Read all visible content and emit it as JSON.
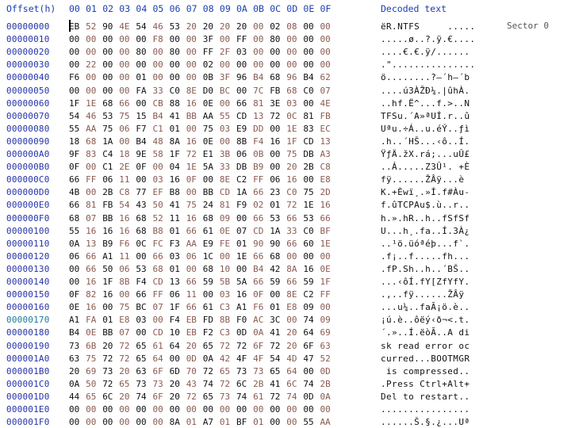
{
  "header": {
    "offset_label": "Offset(h)",
    "columns": [
      "00",
      "01",
      "02",
      "03",
      "04",
      "05",
      "06",
      "07",
      "08",
      "09",
      "0A",
      "0B",
      "0C",
      "0D",
      "0E",
      "0F"
    ],
    "decoded_label": "Decoded text"
  },
  "sector_label": "Sector 0",
  "colors": {
    "header": "#1a3fb0",
    "offset": "#2432a8",
    "byte_dark": "#111111",
    "byte_light": "#8a5a50"
  },
  "rows": [
    {
      "offset": "00000000",
      "bytes": [
        "EB",
        "52",
        "90",
        "4E",
        "54",
        "46",
        "53",
        "20",
        "20",
        "20",
        "20",
        "00",
        "02",
        "08",
        "00",
        "00"
      ],
      "text": "ëR.NTFS     ....."
    },
    {
      "offset": "00000010",
      "bytes": [
        "00",
        "00",
        "00",
        "00",
        "00",
        "F8",
        "00",
        "00",
        "3F",
        "00",
        "FF",
        "00",
        "80",
        "00",
        "00",
        "00"
      ],
      "text": ".....ø..?.ÿ.€...."
    },
    {
      "offset": "00000020",
      "bytes": [
        "00",
        "00",
        "00",
        "00",
        "80",
        "00",
        "80",
        "00",
        "FF",
        "2F",
        "03",
        "00",
        "00",
        "00",
        "00",
        "00"
      ],
      "text": "....€.€.ÿ/......"
    },
    {
      "offset": "00000030",
      "bytes": [
        "00",
        "22",
        "00",
        "00",
        "00",
        "00",
        "00",
        "00",
        "02",
        "00",
        "00",
        "00",
        "00",
        "00",
        "00",
        "00"
      ],
      "text": ".\"..............."
    },
    {
      "offset": "00000040",
      "bytes": [
        "F6",
        "00",
        "00",
        "00",
        "01",
        "00",
        "00",
        "00",
        "0B",
        "3F",
        "96",
        "B4",
        "68",
        "96",
        "B4",
        "62"
      ],
      "text": "ö........?–´h–´b"
    },
    {
      "offset": "00000050",
      "bytes": [
        "00",
        "00",
        "00",
        "00",
        "FA",
        "33",
        "C0",
        "8E",
        "D0",
        "BC",
        "00",
        "7C",
        "FB",
        "68",
        "C0",
        "07"
      ],
      "text": "....ú3ÀŽÐ¼.|ûhÀ."
    },
    {
      "offset": "00000060",
      "bytes": [
        "1F",
        "1E",
        "68",
        "66",
        "00",
        "CB",
        "88",
        "16",
        "0E",
        "00",
        "66",
        "81",
        "3E",
        "03",
        "00",
        "4E"
      ],
      "text": "..hf.Ë^...f.>..N"
    },
    {
      "offset": "00000070",
      "bytes": [
        "54",
        "46",
        "53",
        "75",
        "15",
        "B4",
        "41",
        "BB",
        "AA",
        "55",
        "CD",
        "13",
        "72",
        "0C",
        "81",
        "FB"
      ],
      "text": "TFSu.´A»ªUÍ.r..û"
    },
    {
      "offset": "00000080",
      "bytes": [
        "55",
        "AA",
        "75",
        "06",
        "F7",
        "C1",
        "01",
        "00",
        "75",
        "03",
        "E9",
        "DD",
        "00",
        "1E",
        "83",
        "EC"
      ],
      "text": "Uªu.÷Á..u.éÝ..ƒì"
    },
    {
      "offset": "00000090",
      "bytes": [
        "18",
        "68",
        "1A",
        "00",
        "B4",
        "48",
        "8A",
        "16",
        "0E",
        "00",
        "8B",
        "F4",
        "16",
        "1F",
        "CD",
        "13"
      ],
      "text": ".h..´HŠ...‹ô..Í."
    },
    {
      "offset": "000000A0",
      "bytes": [
        "9F",
        "83",
        "C4",
        "18",
        "9E",
        "58",
        "1F",
        "72",
        "E1",
        "3B",
        "06",
        "0B",
        "00",
        "75",
        "DB",
        "A3"
      ],
      "text": "ŸƒÄ.žX.rá;...uÛ£"
    },
    {
      "offset": "000000B0",
      "bytes": [
        "0F",
        "00",
        "C1",
        "2E",
        "0F",
        "00",
        "04",
        "1E",
        "5A",
        "33",
        "DB",
        "B9",
        "00",
        "20",
        "2B",
        "C8"
      ],
      "text": "..Á.....Z3Û¹. +È"
    },
    {
      "offset": "000000C0",
      "bytes": [
        "66",
        "FF",
        "06",
        "11",
        "00",
        "03",
        "16",
        "0F",
        "00",
        "8E",
        "C2",
        "FF",
        "06",
        "16",
        "00",
        "E8"
      ],
      "text": "fÿ......ŽÂÿ...è"
    },
    {
      "offset": "000000D0",
      "bytes": [
        "4B",
        "00",
        "2B",
        "C8",
        "77",
        "EF",
        "B8",
        "00",
        "BB",
        "CD",
        "1A",
        "66",
        "23",
        "C0",
        "75",
        "2D"
      ],
      "text": "K.+Èwï¸.»Í.f#Àu-"
    },
    {
      "offset": "000000E0",
      "bytes": [
        "66",
        "81",
        "FB",
        "54",
        "43",
        "50",
        "41",
        "75",
        "24",
        "81",
        "F9",
        "02",
        "01",
        "72",
        "1E",
        "16"
      ],
      "text": "f.ûTCPAu$.ù..r.."
    },
    {
      "offset": "000000F0",
      "bytes": [
        "68",
        "07",
        "BB",
        "16",
        "68",
        "52",
        "11",
        "16",
        "68",
        "09",
        "00",
        "66",
        "53",
        "66",
        "53",
        "66"
      ],
      "text": "h.».hR..h..fSfSf"
    },
    {
      "offset": "00000100",
      "bytes": [
        "55",
        "16",
        "16",
        "16",
        "68",
        "B8",
        "01",
        "66",
        "61",
        "0E",
        "07",
        "CD",
        "1A",
        "33",
        "C0",
        "BF"
      ],
      "text": "U...h¸.fa..Í.3À¿"
    },
    {
      "offset": "00000110",
      "bytes": [
        "0A",
        "13",
        "B9",
        "F6",
        "0C",
        "FC",
        "F3",
        "AA",
        "E9",
        "FE",
        "01",
        "90",
        "90",
        "66",
        "60",
        "1E"
      ],
      "text": "..¹ö.üóªéþ...f`."
    },
    {
      "offset": "00000120",
      "bytes": [
        "06",
        "66",
        "A1",
        "11",
        "00",
        "66",
        "03",
        "06",
        "1C",
        "00",
        "1E",
        "66",
        "68",
        "00",
        "00",
        "00"
      ],
      "text": ".f¡..f.....fh..."
    },
    {
      "offset": "00000130",
      "bytes": [
        "00",
        "66",
        "50",
        "06",
        "53",
        "68",
        "01",
        "00",
        "68",
        "10",
        "00",
        "B4",
        "42",
        "8A",
        "16",
        "0E"
      ],
      "text": ".fP.Sh..h..´BŠ.."
    },
    {
      "offset": "00000140",
      "bytes": [
        "00",
        "16",
        "1F",
        "8B",
        "F4",
        "CD",
        "13",
        "66",
        "59",
        "5B",
        "5A",
        "66",
        "59",
        "66",
        "59",
        "1F"
      ],
      "text": "...‹ôÍ.fY[ZfYfY."
    },
    {
      "offset": "00000150",
      "bytes": [
        "0F",
        "82",
        "16",
        "00",
        "66",
        "FF",
        "06",
        "11",
        "00",
        "03",
        "16",
        "0F",
        "00",
        "8E",
        "C2",
        "FF"
      ],
      "text": ".‚..fÿ......ŽÂÿ"
    },
    {
      "offset": "00000160",
      "bytes": [
        "0E",
        "16",
        "00",
        "75",
        "BC",
        "07",
        "1F",
        "66",
        "61",
        "C3",
        "A1",
        "F6",
        "01",
        "E8",
        "09",
        "00"
      ],
      "text": "...u¼..faÃ¡ö.è.."
    },
    {
      "offset": "00000170",
      "accent": true,
      "bytes": [
        "A1",
        "FA",
        "01",
        "E8",
        "03",
        "00",
        "F4",
        "EB",
        "FD",
        "8B",
        "F0",
        "AC",
        "3C",
        "00",
        "74",
        "09"
      ],
      "text": "¡ú.è..ôëý‹ð¬<.t."
    },
    {
      "offset": "00000180",
      "bytes": [
        "B4",
        "0E",
        "BB",
        "07",
        "00",
        "CD",
        "10",
        "EB",
        "F2",
        "C3",
        "0D",
        "0A",
        "41",
        "20",
        "64",
        "69"
      ],
      "text": "´.»..Í.ëòÃ..A di"
    },
    {
      "offset": "00000190",
      "bytes": [
        "73",
        "6B",
        "20",
        "72",
        "65",
        "61",
        "64",
        "20",
        "65",
        "72",
        "72",
        "6F",
        "72",
        "20",
        "6F",
        "63"
      ],
      "text": "sk read error oc"
    },
    {
      "offset": "000001A0",
      "bytes": [
        "63",
        "75",
        "72",
        "72",
        "65",
        "64",
        "00",
        "0D",
        "0A",
        "42",
        "4F",
        "4F",
        "54",
        "4D",
        "47",
        "52"
      ],
      "text": "curred...BOOTMGR"
    },
    {
      "offset": "000001B0",
      "bytes": [
        "20",
        "69",
        "73",
        "20",
        "63",
        "6F",
        "6D",
        "70",
        "72",
        "65",
        "73",
        "73",
        "65",
        "64",
        "00",
        "0D"
      ],
      "text": " is compressed.."
    },
    {
      "offset": "000001C0",
      "bytes": [
        "0A",
        "50",
        "72",
        "65",
        "73",
        "73",
        "20",
        "43",
        "74",
        "72",
        "6C",
        "2B",
        "41",
        "6C",
        "74",
        "2B"
      ],
      "text": ".Press Ctrl+Alt+"
    },
    {
      "offset": "000001D0",
      "bytes": [
        "44",
        "65",
        "6C",
        "20",
        "74",
        "6F",
        "20",
        "72",
        "65",
        "73",
        "74",
        "61",
        "72",
        "74",
        "0D",
        "0A"
      ],
      "text": "Del to restart.."
    },
    {
      "offset": "000001E0",
      "bytes": [
        "00",
        "00",
        "00",
        "00",
        "00",
        "00",
        "00",
        "00",
        "00",
        "00",
        "00",
        "00",
        "00",
        "00",
        "00",
        "00"
      ],
      "text": "................"
    },
    {
      "offset": "000001F0",
      "bytes": [
        "00",
        "00",
        "00",
        "00",
        "00",
        "00",
        "8A",
        "01",
        "A7",
        "01",
        "BF",
        "01",
        "00",
        "00",
        "55",
        "AA"
      ],
      "text": "......Š.§.¿...Uª"
    }
  ]
}
